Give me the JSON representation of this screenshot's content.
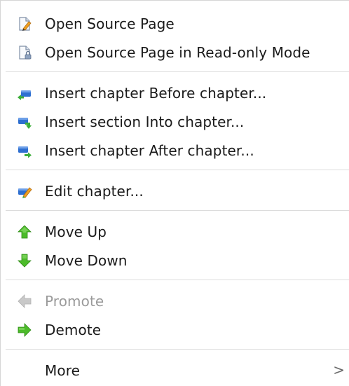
{
  "menu": {
    "items": [
      {
        "label": "Open Source Page",
        "icon": "page-edit-icon",
        "enabled": true
      },
      {
        "label": "Open Source Page in Read-only Mode",
        "icon": "page-readonly-icon",
        "enabled": true
      },
      {
        "label": "Insert chapter Before chapter...",
        "icon": "insert-before-icon",
        "enabled": true
      },
      {
        "label": "Insert section Into chapter...",
        "icon": "insert-into-icon",
        "enabled": true
      },
      {
        "label": "Insert chapter After chapter...",
        "icon": "insert-after-icon",
        "enabled": true
      },
      {
        "label": "Edit chapter...",
        "icon": "edit-icon",
        "enabled": true
      },
      {
        "label": "Move Up",
        "icon": "arrow-up-icon",
        "enabled": true
      },
      {
        "label": "Move Down",
        "icon": "arrow-down-icon",
        "enabled": true
      },
      {
        "label": "Promote",
        "icon": "arrow-left-icon",
        "enabled": false
      },
      {
        "label": "Demote",
        "icon": "arrow-right-icon",
        "enabled": true
      },
      {
        "label": "More",
        "icon": "",
        "enabled": true,
        "submenu_indicator": ">"
      }
    ]
  },
  "colors": {
    "text": "#1a1a1a",
    "disabled_text": "#9a9a9a",
    "separator": "#dcdcdc",
    "arrow_green": "#4cbb2a",
    "insert_blue": "#2e6fd0",
    "insert_green": "#3cae3a"
  }
}
